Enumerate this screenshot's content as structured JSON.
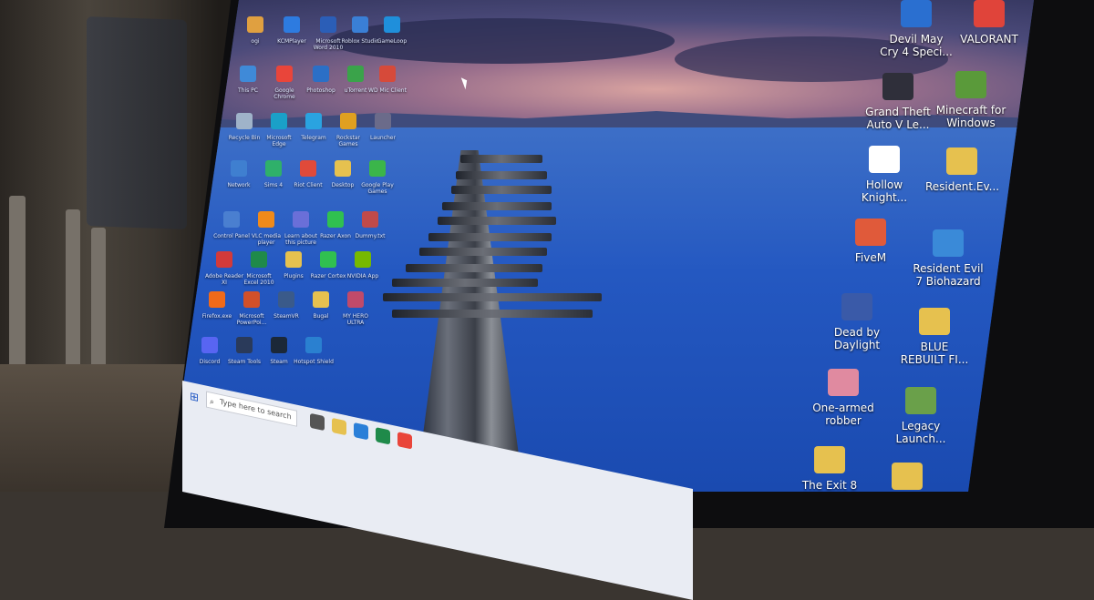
{
  "desktop": {
    "left_icons": [
      {
        "label": "ogi",
        "color": "#e0a040"
      },
      {
        "label": "KCMPlayer",
        "color": "#2d7be0"
      },
      {
        "label": "Microsoft Word 2010",
        "color": "#2b5eb7"
      },
      {
        "label": "Roblox Studio",
        "color": "#3a7fd6"
      },
      {
        "label": "GameLoop",
        "color": "#1f8fdb"
      },
      {
        "label": "This PC",
        "color": "#3f8ad8"
      },
      {
        "label": "Google Chrome",
        "color": "#e9453a"
      },
      {
        "label": "Photoshop",
        "color": "#2b6fc6"
      },
      {
        "label": "uTorrent",
        "color": "#3aa34a"
      },
      {
        "label": "WD Mic Client",
        "color": "#d64a3a"
      },
      {
        "label": "Recycle Bin",
        "color": "#9fb3c9"
      },
      {
        "label": "Microsoft Edge",
        "color": "#1aa0c8"
      },
      {
        "label": "Telegram",
        "color": "#2aa3e0"
      },
      {
        "label": "Rockstar Games",
        "color": "#e0a020"
      },
      {
        "label": "Launcher",
        "color": "#6b6b8a"
      },
      {
        "label": "Network",
        "color": "#3f7fd0"
      },
      {
        "label": "Sims 4",
        "color": "#2fb06a"
      },
      {
        "label": "Riot Client",
        "color": "#e04a3a"
      },
      {
        "label": "Desktop",
        "color": "#e6c14f"
      },
      {
        "label": "Google Play Games",
        "color": "#3bb54a"
      },
      {
        "label": "Control Panel",
        "color": "#4a7fd0"
      },
      {
        "label": "VLC media player",
        "color": "#f08a1a"
      },
      {
        "label": "Learn about this picture",
        "color": "#6a6fd8"
      },
      {
        "label": "Razer Axon",
        "color": "#30c050"
      },
      {
        "label": "Dummy.txt",
        "color": "#c04a4a"
      },
      {
        "label": "Adobe Reader XI",
        "color": "#d23a3a"
      },
      {
        "label": "Microsoft Excel 2010",
        "color": "#1f8a4a"
      },
      {
        "label": "Plugins",
        "color": "#e6c14f"
      },
      {
        "label": "Razer Cortex",
        "color": "#30c050"
      },
      {
        "label": "NVIDIA App",
        "color": "#76b900"
      },
      {
        "label": "Firefox.exe",
        "color": "#f06a1a"
      },
      {
        "label": "Microsoft PowerPoi...",
        "color": "#d2502a"
      },
      {
        "label": "SteamVR",
        "color": "#3a5a8a"
      },
      {
        "label": "Bugal",
        "color": "#e6c14f"
      },
      {
        "label": "MY HERO ULTRA",
        "color": "#c04a6a"
      },
      {
        "label": "Discord",
        "color": "#5865f2"
      },
      {
        "label": "Steam Tools",
        "color": "#2a3a5a"
      },
      {
        "label": "Steam",
        "color": "#1b2838"
      },
      {
        "label": "Hotspot Shield",
        "color": "#2a80d0"
      }
    ],
    "right_icons": [
      {
        "label": "Devil May Cry 4 Speci...",
        "color": "#2a6fd0"
      },
      {
        "label": "VALORANT",
        "color": "#e0443a"
      },
      {
        "label": "Grand Theft Auto V Le...",
        "color": "#2f2f3a"
      },
      {
        "label": "Minecraft for Windows",
        "color": "#5a9a3a"
      },
      {
        "label": "Hollow Knight...",
        "color": "#ffffff"
      },
      {
        "label": "Resident.Ev...",
        "color": "#e6c14f"
      },
      {
        "label": "FiveM",
        "color": "#e05a3a"
      },
      {
        "label": "Resident Evil 7 Biohazard",
        "color": "#3a8ad8"
      },
      {
        "label": "Dead by Daylight",
        "color": "#3a5aa8"
      },
      {
        "label": "BLUE REBUILT FI...",
        "color": "#e6c14f"
      },
      {
        "label": "One-armed robber",
        "color": "#e08aa0"
      },
      {
        "label": "Legacy Launch...",
        "color": "#6aa04a"
      },
      {
        "label": "The Exit 8",
        "color": "#e6c14f"
      },
      {
        "label": "",
        "color": "#e6c14f"
      }
    ]
  },
  "taskbar": {
    "search_placeholder": "Type here to search",
    "start_icon": "windows-start-icon",
    "pinned": [
      {
        "name": "task-view-icon",
        "color": "#555"
      },
      {
        "name": "file-explorer-icon",
        "color": "#e6c14f"
      },
      {
        "name": "store-icon",
        "color": "#2a7fd8"
      },
      {
        "name": "excel-icon",
        "color": "#1f8a4a"
      },
      {
        "name": "chrome-icon",
        "color": "#e9453a"
      }
    ]
  }
}
